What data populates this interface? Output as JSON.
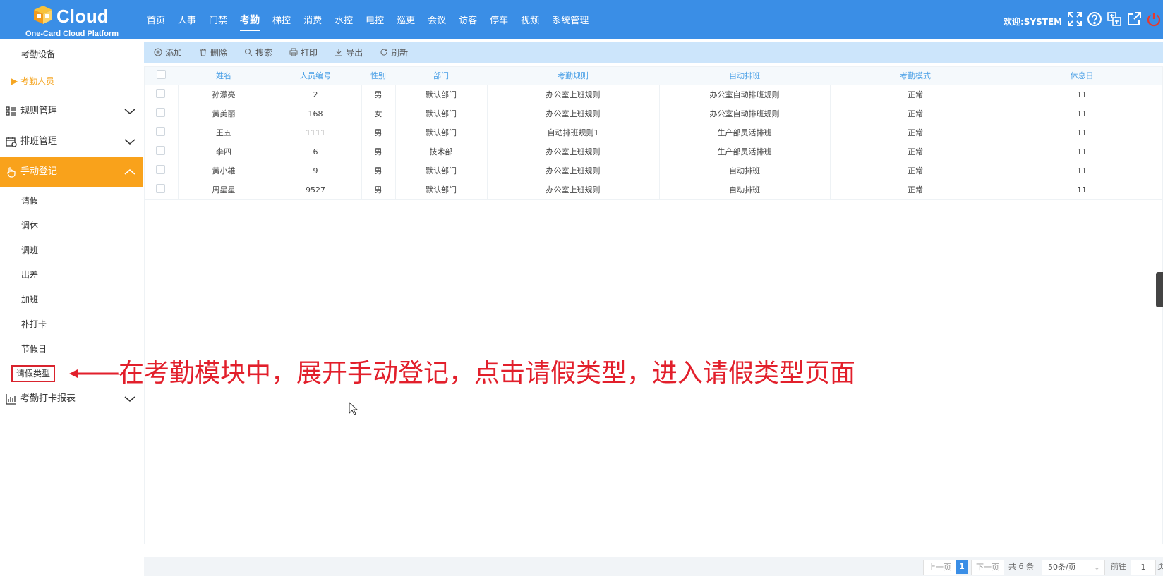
{
  "app": {
    "logo_text": "Cloud",
    "logo_sub": "One-Card Cloud Platform",
    "welcome": "欢迎:SYSTEM"
  },
  "nav": [
    "首页",
    "人事",
    "门禁",
    "考勤",
    "梯控",
    "消费",
    "水控",
    "电控",
    "巡更",
    "会议",
    "访客",
    "停车",
    "视频",
    "系统管理"
  ],
  "nav_active": "考勤",
  "sidebar": {
    "top_items": [
      "考勤设备",
      "考勤人员"
    ],
    "groups": {
      "rules": "规则管理",
      "scheduling": "排班管理",
      "manual": "手动登记",
      "report": "考勤打卡报表"
    },
    "manual_items": [
      "请假",
      "调休",
      "调班",
      "出差",
      "加班",
      "补打卡",
      "节假日",
      "请假类型"
    ]
  },
  "toolbar": {
    "add": "添加",
    "delete": "删除",
    "search": "搜索",
    "print": "打印",
    "export": "导出",
    "refresh": "刷新"
  },
  "table": {
    "columns": [
      "姓名",
      "人员编号",
      "性别",
      "部门",
      "考勤规则",
      "自动排班",
      "考勤模式",
      "休息日"
    ],
    "rows": [
      [
        "孙濛亮",
        "2",
        "男",
        "默认部门",
        "办公室上班规则",
        "办公室自动排班规则",
        "正常",
        "11"
      ],
      [
        "黄美丽",
        "168",
        "女",
        "默认部门",
        "办公室上班规则",
        "办公室自动排班规则",
        "正常",
        "11"
      ],
      [
        "王五",
        "1111",
        "男",
        "默认部门",
        "自动排班规则1",
        "生产部灵活排班",
        "正常",
        "11"
      ],
      [
        "李四",
        "6",
        "男",
        "技术部",
        "办公室上班规则",
        "生产部灵活排班",
        "正常",
        "11"
      ],
      [
        "黄小雄",
        "9",
        "男",
        "默认部门",
        "办公室上班规则",
        "自动排班",
        "正常",
        "11"
      ],
      [
        "周星星",
        "9527",
        "男",
        "默认部门",
        "办公室上班规则",
        "自动排班",
        "正常",
        "11"
      ]
    ]
  },
  "pager": {
    "prev": "上一页",
    "current": "1",
    "next": "下一页",
    "total": "共 6 条",
    "page_size": "50条/页",
    "goto": "前往",
    "goto_value": "1",
    "page_unit": "页"
  },
  "annotation": "在考勤模块中，展开手动登记，点击请假类型，进入请假类型页面",
  "colors": {
    "primary": "#3a8ee6",
    "accent": "#f9a21b",
    "annotation": "#e21f2b"
  }
}
